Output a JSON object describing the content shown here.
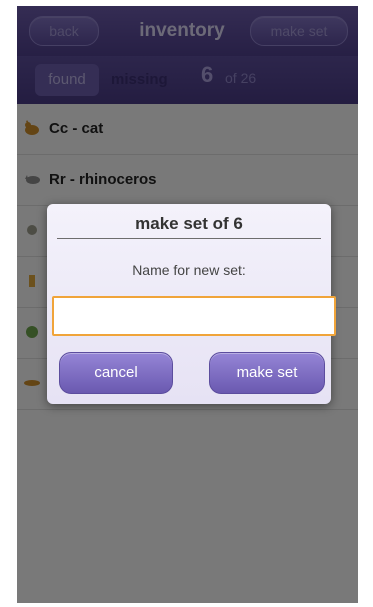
{
  "header": {
    "back_label": "back",
    "title": "inventory",
    "make_set_label": "make set"
  },
  "tabs": {
    "found_label": "found",
    "missing_label": "missing",
    "count": "6",
    "count_suffix": "of 26"
  },
  "list": {
    "items": [
      {
        "label": "Cc - cat",
        "icon": "cat-icon"
      },
      {
        "label": "Rr - rhinoceros",
        "icon": "rhinoceros-icon"
      },
      {
        "label": "",
        "icon": "animal-icon"
      },
      {
        "label": "",
        "icon": "animal-icon"
      },
      {
        "label": "",
        "icon": "animal-icon"
      },
      {
        "label": "",
        "icon": "animal-icon"
      }
    ]
  },
  "dialog": {
    "title": "make set of 6",
    "prompt": "Name for new set:",
    "input_value": "",
    "cancel_label": "cancel",
    "make_set_label": "make set"
  },
  "colors": {
    "accent": "#5a4c98",
    "input_focus": "#f0a43a"
  }
}
